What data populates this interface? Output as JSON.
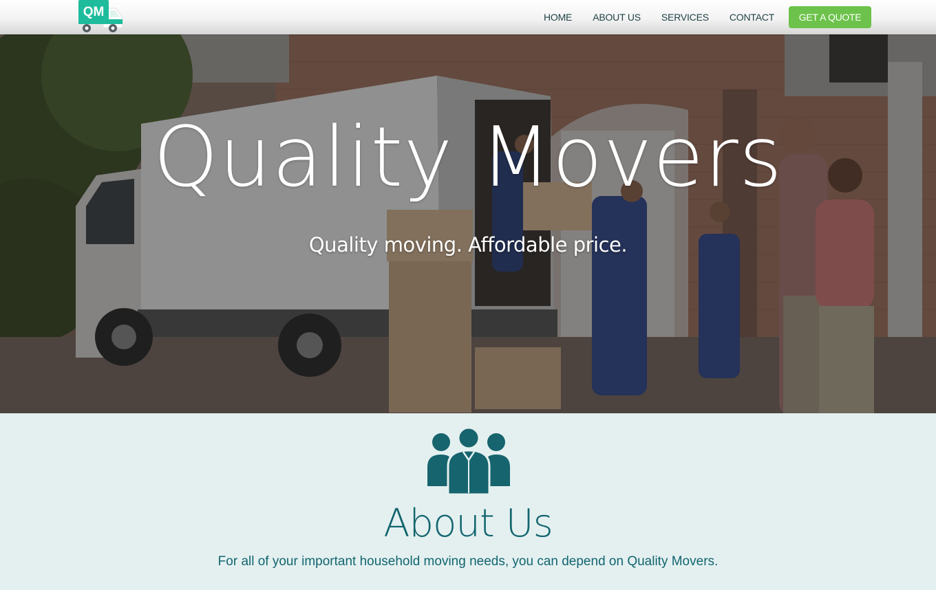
{
  "header": {
    "logo_text": "QM",
    "nav": [
      "HOME",
      "ABOUT US",
      "SERVICES",
      "CONTACT"
    ],
    "cta_label": "GET A QUOTE"
  },
  "hero": {
    "title": "Quality Movers",
    "tagline": "Quality moving. Affordable price."
  },
  "about": {
    "icon": "people-group-icon",
    "title": "About Us",
    "text": "For all of your important household moving needs, you can depend on Quality Movers."
  },
  "colors": {
    "accent_green": "#6cc24a",
    "logo_teal": "#1ebc9c",
    "brand_teal": "#12656f",
    "about_bg": "#e4f0f0",
    "nav_text": "#1f3f44"
  }
}
